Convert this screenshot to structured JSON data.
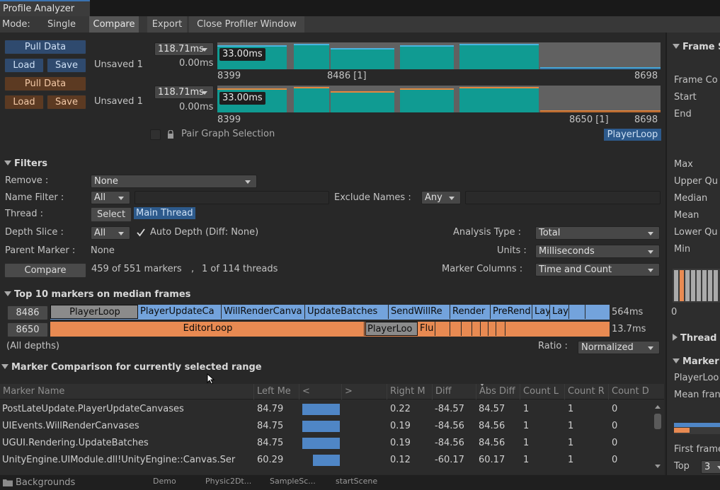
{
  "window": {
    "title": "Profile Analyzer"
  },
  "menu": {
    "mode_label": "Mode:",
    "single": "Single",
    "compare": "Compare",
    "export": "Export",
    "close": "Close Profiler Window"
  },
  "data1": {
    "pull": "Pull Data",
    "load": "Load",
    "save": "Save",
    "status": "Unsaved 1",
    "range": "118.71ms",
    "zero": "0.00ms",
    "tooltip": "33.00ms",
    "start": "8399",
    "marker": "8486 [1]",
    "end": "8698"
  },
  "data2": {
    "pull": "Pull Data",
    "load": "Load",
    "save": "Save",
    "status": "Unsaved 1",
    "range": "118.71ms",
    "zero": "0.00ms",
    "tooltip": "33.00ms",
    "start": "8399",
    "marker": "8650 [1]",
    "end": "8698"
  },
  "pair": {
    "label": "Pair Graph Selection",
    "selection_tag": "PlayerLoop"
  },
  "filters": {
    "title": "Filters",
    "remove_label": "Remove :",
    "remove_value": "None",
    "name_filter_label": "Name Filter :",
    "name_filter_value": "All",
    "exclude_label": "Exclude Names :",
    "exclude_value": "Any",
    "thread_label": "Thread :",
    "select_btn": "Select",
    "thread_value": "Main Thread",
    "depth_label": "Depth Slice :",
    "depth_value": "All",
    "auto_depth": "Auto Depth (Diff: None)",
    "analysis_label": "Analysis Type :",
    "analysis_value": "Total",
    "parent_label": "Parent Marker :",
    "parent_value": "None",
    "units_label": "Units :",
    "units_value": "Milliseconds",
    "compare_btn": "Compare",
    "markers_count": "459 of 551 markers",
    "sep": ",",
    "threads_count": "1 of 114 threads",
    "columns_label": "Marker Columns :",
    "columns_value": "Time and Count"
  },
  "top10": {
    "title": "Top 10 markers on median frames",
    "row1": {
      "frame": "8486",
      "total": "564ms",
      "markers": [
        "PlayerLoop",
        "PlayerUpdateCa",
        "WillRenderCanva",
        "UpdateBatches",
        "SendWillRe",
        "Render",
        "PreRend",
        "Lay",
        "Lay"
      ]
    },
    "row2": {
      "frame": "8650",
      "total": "13.7ms",
      "markers": [
        "EditorLoop",
        "PlayerLoo",
        "Flu"
      ]
    },
    "all_depths": "(All depths)",
    "ratio_label": "Ratio :",
    "ratio_value": "Normalized"
  },
  "comparison": {
    "title": "Marker Comparison for currently selected range",
    "headers": [
      "Marker Name",
      "Left Me",
      "<",
      ">",
      "Right M",
      "Diff",
      "Abs Diff",
      "Count L",
      "Count R",
      "Count D"
    ],
    "rows": [
      {
        "name": "PostLateUpdate.PlayerUpdateCanvases",
        "left": "84.79",
        "right": "0.22",
        "diff": "-84.57",
        "abs": "84.57",
        "cl": "1",
        "cr": "1",
        "cd": "0",
        "bar": 0.99
      },
      {
        "name": "UIEvents.WillRenderCanvases",
        "left": "84.75",
        "right": "0.19",
        "diff": "-84.56",
        "abs": "84.56",
        "cl": "1",
        "cr": "1",
        "cd": "0",
        "bar": 0.99
      },
      {
        "name": "UGUI.Rendering.UpdateBatches",
        "left": "84.75",
        "right": "0.19",
        "diff": "-84.56",
        "abs": "84.56",
        "cl": "1",
        "cr": "1",
        "cd": "0",
        "bar": 0.99
      },
      {
        "name": "UnityEngine.UIModule.dll!UnityEngine::Canvas.Ser",
        "left": "60.29",
        "right": "0.12",
        "diff": "-60.17",
        "abs": "60.17",
        "cl": "1",
        "cr": "1",
        "cd": "0",
        "bar": 0.71
      }
    ]
  },
  "right_panel": {
    "frame_title": "Frame S",
    "frame_count": "Frame Co",
    "start": "Start",
    "end": "End",
    "max": "Max",
    "upper": "Upper Qu",
    "median": "Median",
    "mean": "Mean",
    "lower": "Lower Qu",
    "min": "Min",
    "axis_zero": "0",
    "thread_title": "Thread",
    "marker_title": "Marker",
    "marker_name": "PlayerLoo",
    "mean_frame": "Mean fran",
    "first_frame": "First frame",
    "top_label": "Top",
    "top_value": "3"
  },
  "bottom": {
    "backgrounds": "Backgrounds",
    "tabs": [
      "Demo",
      "Physic2Dt...",
      "SampleSc...",
      "startScene"
    ]
  },
  "colors": {
    "teal": "#109b92",
    "blue": "#4f86c6",
    "orange": "#e88a52",
    "bg": "#282828"
  }
}
